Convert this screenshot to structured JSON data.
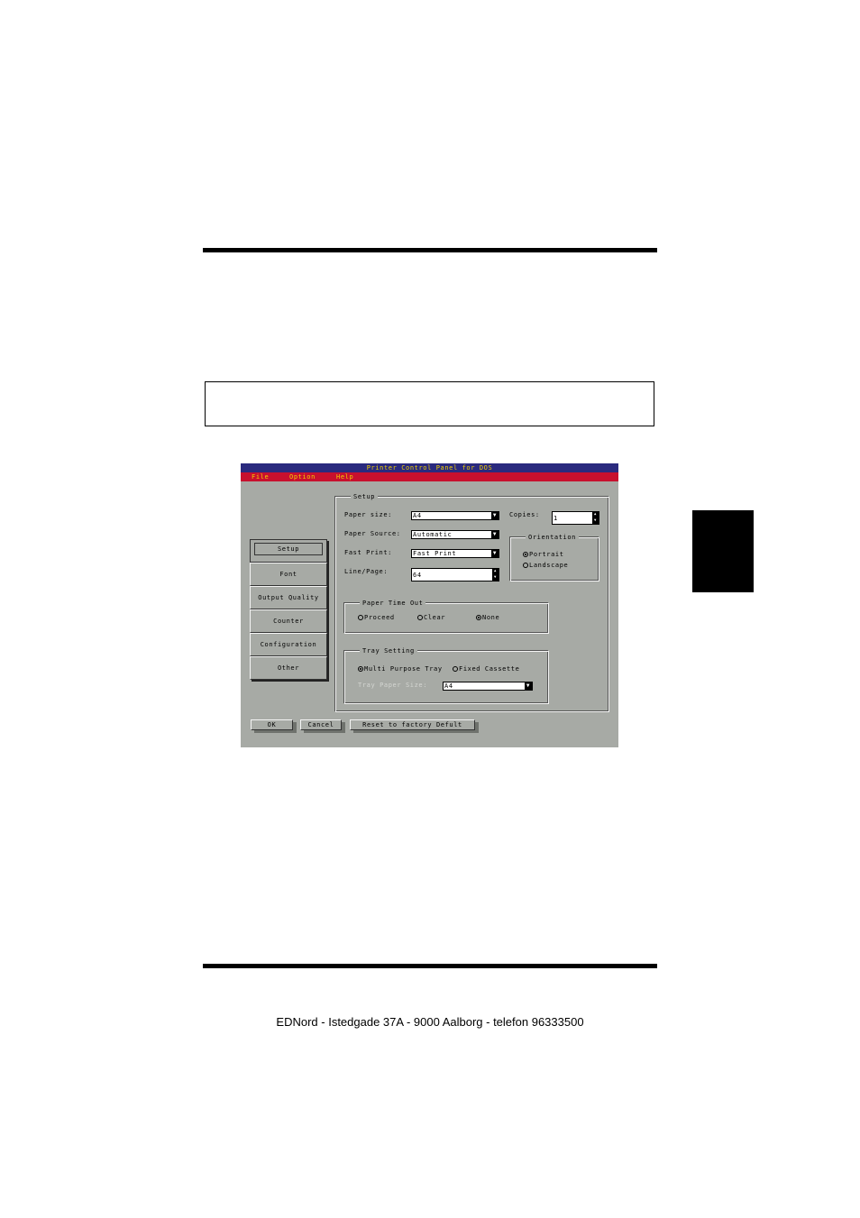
{
  "footer": {
    "text": "EDNord - Istedgade 37A - 9000 Aalborg - telefon 96333500"
  },
  "window": {
    "title": "Printer Control Panel for DOS",
    "menu": [
      "File",
      "Option",
      "Help"
    ]
  },
  "tabs": [
    "Setup",
    "Font",
    "Output Quality",
    "Counter",
    "Configuration",
    "Other"
  ],
  "setup": {
    "title": "Setup",
    "paper_size_label": "Paper size:",
    "paper_size_value": "A4",
    "paper_source_label": "Paper Source:",
    "paper_source_value": "Automatic",
    "fast_print_label": "Fast Print:",
    "fast_print_value": "Fast Print",
    "line_page_label": "Line/Page:",
    "line_page_value": "64",
    "copies_label": "Copies:",
    "copies_value": "1"
  },
  "orientation": {
    "title": "Orientation",
    "portrait": "Portrait",
    "landscape": "Landscape"
  },
  "paper_time_out": {
    "title": "Paper Time Out",
    "proceed": "Proceed",
    "clear": "Clear",
    "none": "None"
  },
  "tray_setting": {
    "title": "Tray Setting",
    "multi_purpose": "Multi Purpose Tray",
    "fixed_cassette": "Fixed Cassette",
    "tray_paper_size_label": "Tray Paper Size:",
    "tray_paper_size_value": "A4"
  },
  "buttons": {
    "ok": "OK",
    "cancel": "Cancel",
    "reset": "Reset to factory Defult"
  }
}
